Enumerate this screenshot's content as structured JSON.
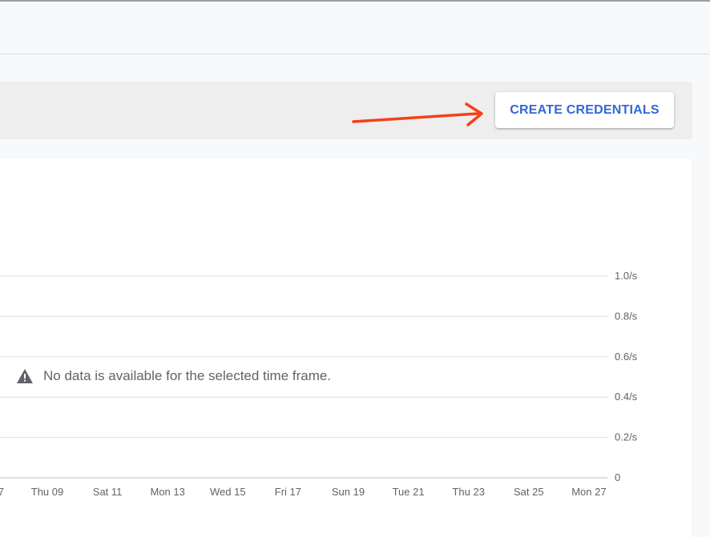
{
  "toolbar": {
    "create_credentials_label": "CREATE CREDENTIALS"
  },
  "colors": {
    "accent_blue": "#3367d6",
    "annotation_arrow": "#f4401a",
    "grid_line": "#e0e0e0"
  },
  "chart": {
    "no_data_message": "No data is available for the selected time frame.",
    "no_data_icon": "warning-icon"
  },
  "chart_data": {
    "type": "line",
    "x_ticks": [
      "7",
      "Thu 09",
      "Sat 11",
      "Mon 13",
      "Wed 15",
      "Fri 17",
      "Sun 19",
      "Tue 21",
      "Thu 23",
      "Sat 25",
      "Mon 27"
    ],
    "y_ticks": [
      "0",
      "0.2/s",
      "0.4/s",
      "0.6/s",
      "0.8/s",
      "1.0/s"
    ],
    "ylim": [
      0,
      1.0
    ],
    "y_axis_position": "right",
    "grid": true,
    "series": []
  }
}
